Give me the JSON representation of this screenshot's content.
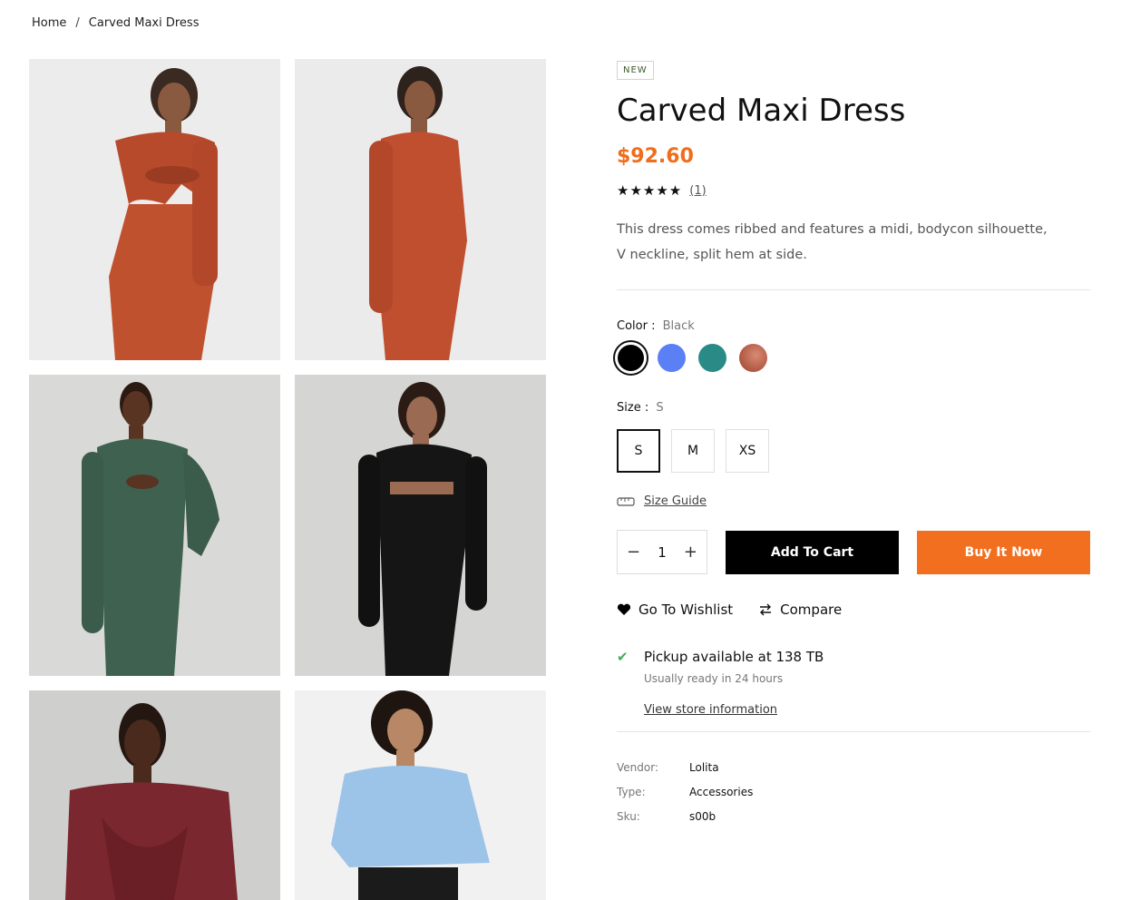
{
  "breadcrumb": {
    "home": "Home",
    "separator": "/",
    "current": "Carved Maxi Dress"
  },
  "gallery": {
    "images": [
      {
        "label": "rust-dress-front"
      },
      {
        "label": "rust-dress-side"
      },
      {
        "label": "green-dress"
      },
      {
        "label": "black-dress"
      },
      {
        "label": "burgundy-dress"
      },
      {
        "label": "blue-sweater"
      }
    ]
  },
  "product": {
    "badge": "NEW",
    "title": "Carved Maxi Dress",
    "price": "$92.60",
    "stars": "★★★★★",
    "review_count": "(1)",
    "description": "This dress comes ribbed and features a midi, bodycon silhouette, V neckline, split hem at side."
  },
  "color": {
    "label": "Color :",
    "selected": "Black",
    "swatches": [
      "#000000",
      "#5b7ff5",
      "#2a8b86",
      "#b4553d"
    ]
  },
  "size": {
    "label": "Size :",
    "selected": "S",
    "options": [
      "S",
      "M",
      "XS"
    ]
  },
  "size_guide": {
    "label": "Size Guide",
    "icon": "ruler-icon"
  },
  "purchase": {
    "minus": "−",
    "quantity": "1",
    "plus": "+",
    "add_to_cart": "Add To Cart",
    "buy_now": "Buy It Now"
  },
  "links": {
    "wishlist": "Go To Wishlist",
    "compare": "Compare"
  },
  "pickup": {
    "title": "Pickup available at 138 TB",
    "subtitle": "Usually ready in 24 hours",
    "link": "View store information"
  },
  "meta": {
    "vendor_label": "Vendor:",
    "vendor": "Lolita",
    "type_label": "Type:",
    "type": "Accessories",
    "sku_label": "Sku:",
    "sku": "s00b"
  },
  "colors": {
    "accent": "#f36f20",
    "price": "#ee6e1b",
    "check": "#3fae5a"
  }
}
